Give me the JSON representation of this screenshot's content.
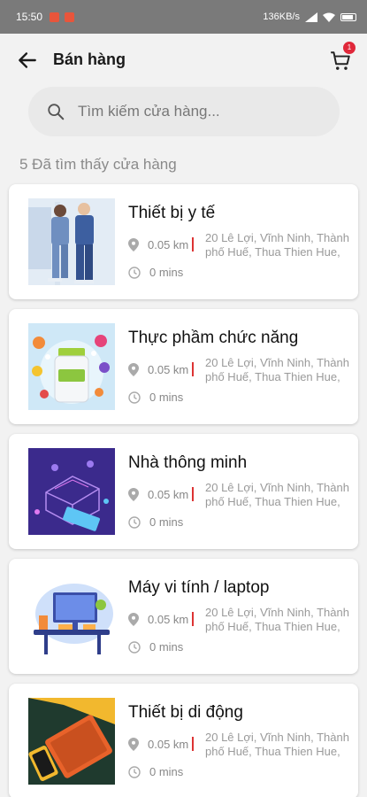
{
  "status_bar": {
    "time": "15:50",
    "network_speed": "136KB/s"
  },
  "header": {
    "title": "Bán hàng",
    "cart_count": "1"
  },
  "search": {
    "placeholder": "Tìm kiếm cửa hàng..."
  },
  "results_label": "5 Đã tìm thấy cửa hàng",
  "stores": [
    {
      "name": "Thiết bị y tế",
      "distance": "0.05 km",
      "address": "20 Lê Lợi, Vĩnh Ninh, Thành phố Huế, Thua Thien Hue,",
      "time": "0 mins",
      "image": "medical-staff-illustration"
    },
    {
      "name": "Thực phầm chức năng",
      "distance": "0.05 km",
      "address": "20 Lê Lợi, Vĩnh Ninh, Thành phố Huế, Thua Thien Hue,",
      "time": "0 mins",
      "image": "vitamin-bottle-illustration"
    },
    {
      "name": "Nhà thông minh",
      "distance": "0.05 km",
      "address": "20 Lê Lợi, Vĩnh Ninh, Thành phố Huế, Thua Thien Hue,",
      "time": "0 mins",
      "image": "smart-home-illustration"
    },
    {
      "name": "Máy vi tính / laptop",
      "distance": "0.05 km",
      "address": "20 Lê Lợi, Vĩnh Ninh, Thành phố Huế, Thua Thien Hue,",
      "time": "0 mins",
      "image": "computer-desk-illustration"
    },
    {
      "name": "Thiết bị di động",
      "distance": "0.05 km",
      "address": "20 Lê Lợi, Vĩnh Ninh, Thành phố Huế, Thua Thien Hue,",
      "time": "0 mins",
      "image": "mobile-devices-illustration"
    }
  ]
}
